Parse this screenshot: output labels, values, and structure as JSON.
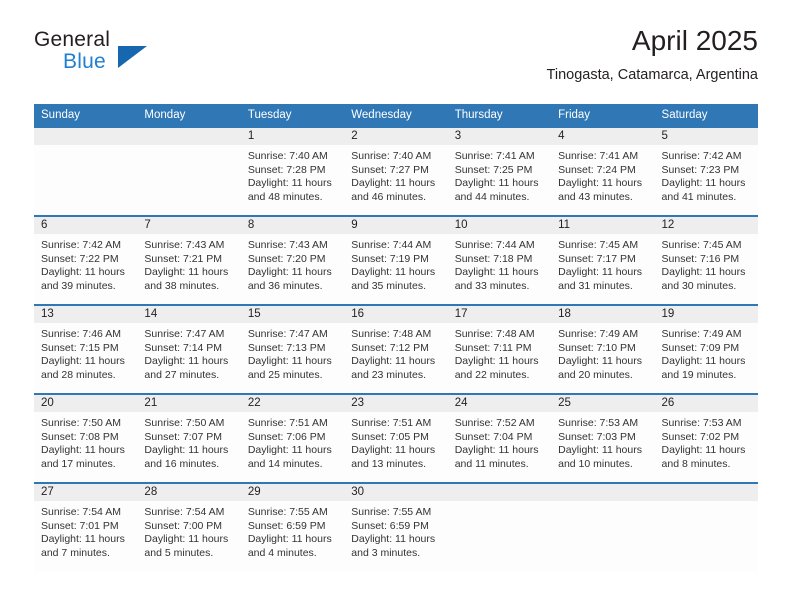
{
  "brand": {
    "name_top": "General",
    "name_bottom": "Blue",
    "accent_color": "#1f7fd1",
    "triangle_color": "#1667b0"
  },
  "header": {
    "title": "April 2025",
    "location": "Tinogasta, Catamarca, Argentina"
  },
  "theme": {
    "header_band": "#3077b6",
    "daynum_band": "#eeeeee",
    "cell_bg": "#fdfdfd",
    "text": "#231f20",
    "detail_text": "#333333"
  },
  "weekday_headers": [
    "Sunday",
    "Monday",
    "Tuesday",
    "Wednesday",
    "Thursday",
    "Friday",
    "Saturday"
  ],
  "labels": {
    "sunrise_prefix": "Sunrise:",
    "sunset_prefix": "Sunset:",
    "daylight_prefix": "Daylight:"
  },
  "weeks": [
    [
      {
        "day": "",
        "sunrise": "",
        "sunset": "",
        "daylight_1": "",
        "daylight_2": "",
        "empty": true
      },
      {
        "day": "",
        "sunrise": "",
        "sunset": "",
        "daylight_1": "",
        "daylight_2": "",
        "empty": true
      },
      {
        "day": "1",
        "sunrise": "Sunrise: 7:40 AM",
        "sunset": "Sunset: 7:28 PM",
        "daylight_1": "Daylight: 11 hours",
        "daylight_2": "and 48 minutes."
      },
      {
        "day": "2",
        "sunrise": "Sunrise: 7:40 AM",
        "sunset": "Sunset: 7:27 PM",
        "daylight_1": "Daylight: 11 hours",
        "daylight_2": "and 46 minutes."
      },
      {
        "day": "3",
        "sunrise": "Sunrise: 7:41 AM",
        "sunset": "Sunset: 7:25 PM",
        "daylight_1": "Daylight: 11 hours",
        "daylight_2": "and 44 minutes."
      },
      {
        "day": "4",
        "sunrise": "Sunrise: 7:41 AM",
        "sunset": "Sunset: 7:24 PM",
        "daylight_1": "Daylight: 11 hours",
        "daylight_2": "and 43 minutes."
      },
      {
        "day": "5",
        "sunrise": "Sunrise: 7:42 AM",
        "sunset": "Sunset: 7:23 PM",
        "daylight_1": "Daylight: 11 hours",
        "daylight_2": "and 41 minutes."
      }
    ],
    [
      {
        "day": "6",
        "sunrise": "Sunrise: 7:42 AM",
        "sunset": "Sunset: 7:22 PM",
        "daylight_1": "Daylight: 11 hours",
        "daylight_2": "and 39 minutes."
      },
      {
        "day": "7",
        "sunrise": "Sunrise: 7:43 AM",
        "sunset": "Sunset: 7:21 PM",
        "daylight_1": "Daylight: 11 hours",
        "daylight_2": "and 38 minutes."
      },
      {
        "day": "8",
        "sunrise": "Sunrise: 7:43 AM",
        "sunset": "Sunset: 7:20 PM",
        "daylight_1": "Daylight: 11 hours",
        "daylight_2": "and 36 minutes."
      },
      {
        "day": "9",
        "sunrise": "Sunrise: 7:44 AM",
        "sunset": "Sunset: 7:19 PM",
        "daylight_1": "Daylight: 11 hours",
        "daylight_2": "and 35 minutes."
      },
      {
        "day": "10",
        "sunrise": "Sunrise: 7:44 AM",
        "sunset": "Sunset: 7:18 PM",
        "daylight_1": "Daylight: 11 hours",
        "daylight_2": "and 33 minutes."
      },
      {
        "day": "11",
        "sunrise": "Sunrise: 7:45 AM",
        "sunset": "Sunset: 7:17 PM",
        "daylight_1": "Daylight: 11 hours",
        "daylight_2": "and 31 minutes."
      },
      {
        "day": "12",
        "sunrise": "Sunrise: 7:45 AM",
        "sunset": "Sunset: 7:16 PM",
        "daylight_1": "Daylight: 11 hours",
        "daylight_2": "and 30 minutes."
      }
    ],
    [
      {
        "day": "13",
        "sunrise": "Sunrise: 7:46 AM",
        "sunset": "Sunset: 7:15 PM",
        "daylight_1": "Daylight: 11 hours",
        "daylight_2": "and 28 minutes."
      },
      {
        "day": "14",
        "sunrise": "Sunrise: 7:47 AM",
        "sunset": "Sunset: 7:14 PM",
        "daylight_1": "Daylight: 11 hours",
        "daylight_2": "and 27 minutes."
      },
      {
        "day": "15",
        "sunrise": "Sunrise: 7:47 AM",
        "sunset": "Sunset: 7:13 PM",
        "daylight_1": "Daylight: 11 hours",
        "daylight_2": "and 25 minutes."
      },
      {
        "day": "16",
        "sunrise": "Sunrise: 7:48 AM",
        "sunset": "Sunset: 7:12 PM",
        "daylight_1": "Daylight: 11 hours",
        "daylight_2": "and 23 minutes."
      },
      {
        "day": "17",
        "sunrise": "Sunrise: 7:48 AM",
        "sunset": "Sunset: 7:11 PM",
        "daylight_1": "Daylight: 11 hours",
        "daylight_2": "and 22 minutes."
      },
      {
        "day": "18",
        "sunrise": "Sunrise: 7:49 AM",
        "sunset": "Sunset: 7:10 PM",
        "daylight_1": "Daylight: 11 hours",
        "daylight_2": "and 20 minutes."
      },
      {
        "day": "19",
        "sunrise": "Sunrise: 7:49 AM",
        "sunset": "Sunset: 7:09 PM",
        "daylight_1": "Daylight: 11 hours",
        "daylight_2": "and 19 minutes."
      }
    ],
    [
      {
        "day": "20",
        "sunrise": "Sunrise: 7:50 AM",
        "sunset": "Sunset: 7:08 PM",
        "daylight_1": "Daylight: 11 hours",
        "daylight_2": "and 17 minutes."
      },
      {
        "day": "21",
        "sunrise": "Sunrise: 7:50 AM",
        "sunset": "Sunset: 7:07 PM",
        "daylight_1": "Daylight: 11 hours",
        "daylight_2": "and 16 minutes."
      },
      {
        "day": "22",
        "sunrise": "Sunrise: 7:51 AM",
        "sunset": "Sunset: 7:06 PM",
        "daylight_1": "Daylight: 11 hours",
        "daylight_2": "and 14 minutes."
      },
      {
        "day": "23",
        "sunrise": "Sunrise: 7:51 AM",
        "sunset": "Sunset: 7:05 PM",
        "daylight_1": "Daylight: 11 hours",
        "daylight_2": "and 13 minutes."
      },
      {
        "day": "24",
        "sunrise": "Sunrise: 7:52 AM",
        "sunset": "Sunset: 7:04 PM",
        "daylight_1": "Daylight: 11 hours",
        "daylight_2": "and 11 minutes."
      },
      {
        "day": "25",
        "sunrise": "Sunrise: 7:53 AM",
        "sunset": "Sunset: 7:03 PM",
        "daylight_1": "Daylight: 11 hours",
        "daylight_2": "and 10 minutes."
      },
      {
        "day": "26",
        "sunrise": "Sunrise: 7:53 AM",
        "sunset": "Sunset: 7:02 PM",
        "daylight_1": "Daylight: 11 hours",
        "daylight_2": "and 8 minutes."
      }
    ],
    [
      {
        "day": "27",
        "sunrise": "Sunrise: 7:54 AM",
        "sunset": "Sunset: 7:01 PM",
        "daylight_1": "Daylight: 11 hours",
        "daylight_2": "and 7 minutes."
      },
      {
        "day": "28",
        "sunrise": "Sunrise: 7:54 AM",
        "sunset": "Sunset: 7:00 PM",
        "daylight_1": "Daylight: 11 hours",
        "daylight_2": "and 5 minutes."
      },
      {
        "day": "29",
        "sunrise": "Sunrise: 7:55 AM",
        "sunset": "Sunset: 6:59 PM",
        "daylight_1": "Daylight: 11 hours",
        "daylight_2": "and 4 minutes."
      },
      {
        "day": "30",
        "sunrise": "Sunrise: 7:55 AM",
        "sunset": "Sunset: 6:59 PM",
        "daylight_1": "Daylight: 11 hours",
        "daylight_2": "and 3 minutes."
      },
      {
        "day": "",
        "sunrise": "",
        "sunset": "",
        "daylight_1": "",
        "daylight_2": "",
        "empty": true
      },
      {
        "day": "",
        "sunrise": "",
        "sunset": "",
        "daylight_1": "",
        "daylight_2": "",
        "empty": true
      },
      {
        "day": "",
        "sunrise": "",
        "sunset": "",
        "daylight_1": "",
        "daylight_2": "",
        "empty": true
      }
    ]
  ]
}
